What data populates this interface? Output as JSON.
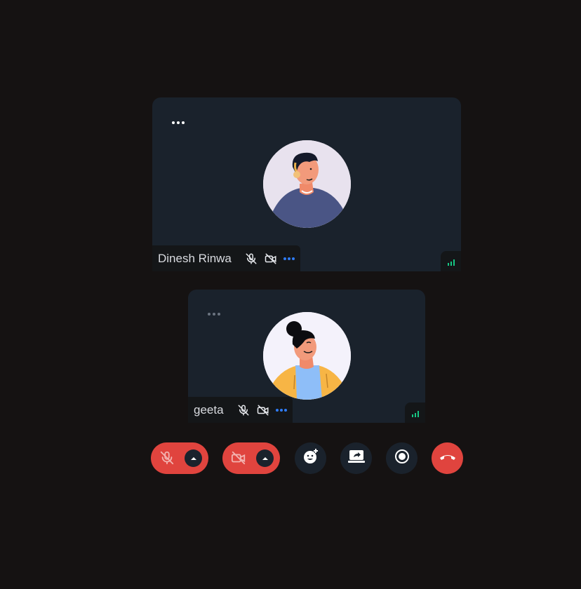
{
  "participants": [
    {
      "name": "Dinesh Rinwa",
      "avatar": "male-avatar-illustration",
      "mic": "muted",
      "camera": "off",
      "options_icon": "more-horizontal-icon",
      "signal": "strong"
    },
    {
      "name": "geeta",
      "avatar": "female-avatar-illustration",
      "mic": "muted",
      "camera": "off",
      "options_icon": "more-horizontal-icon",
      "signal": "strong"
    }
  ],
  "controls": [
    {
      "id": "mic",
      "icon": "mic-off-icon",
      "state": "off"
    },
    {
      "id": "camera",
      "icon": "video-off-icon",
      "state": "off"
    },
    {
      "id": "reactions",
      "icon": "emoji-add-icon"
    },
    {
      "id": "screenshare",
      "icon": "screen-share-icon"
    },
    {
      "id": "record",
      "icon": "record-icon"
    },
    {
      "id": "leave",
      "icon": "end-call-icon"
    }
  ],
  "colors": {
    "background": "#151212",
    "tile": "#1a222c",
    "danger": "#e0443e",
    "accent": "#2f7cf6",
    "signal": "#16c784"
  }
}
